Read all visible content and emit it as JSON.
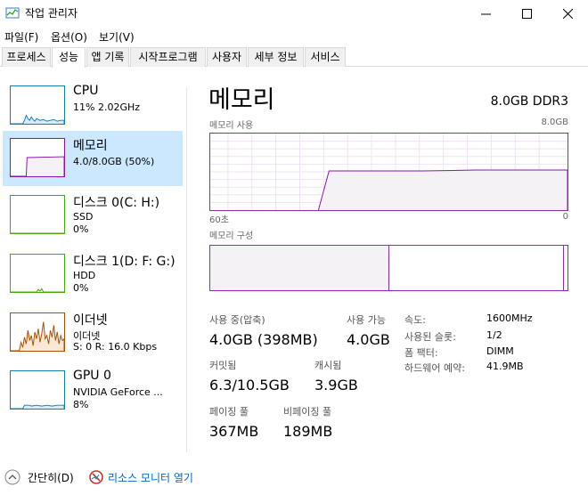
{
  "window": {
    "title": "작업 관리자"
  },
  "menu": [
    "파일(F)",
    "옵션(O)",
    "보기(V)"
  ],
  "tabs": [
    "프로세스",
    "성능",
    "앱 기록",
    "시작프로그램",
    "사용자",
    "세부 정보",
    "서비스"
  ],
  "sidebar": {
    "items": [
      {
        "title": "CPU",
        "lines": [
          "11% 2.02GHz"
        ],
        "color": "#117dbb"
      },
      {
        "title": "메모리",
        "lines": [
          "4.0/8.0GB (50%)"
        ],
        "color": "#8b12ae"
      },
      {
        "title": "디스크 0(C: H:)",
        "lines": [
          "SSD",
          "0%"
        ],
        "color": "#4da60c"
      },
      {
        "title": "디스크 1(D: F: G:)",
        "lines": [
          "HDD",
          "0%"
        ],
        "color": "#4da60c"
      },
      {
        "title": "이더넷",
        "lines": [
          "이더넷",
          "S: 0 R: 16.0 Kbps"
        ],
        "color": "#a74f01"
      },
      {
        "title": "GPU 0",
        "lines": [
          "NVIDIA GeForce ...",
          "8%"
        ],
        "color": "#117dbb"
      }
    ]
  },
  "main": {
    "title": "메모리",
    "spec": "8.0GB DDR3",
    "usage_label": "메모리 사용",
    "usage_max": "8.0GB",
    "time_left": "60초",
    "time_right": "0",
    "composition_label": "메모리 구성",
    "composition_used_fraction": 0.5,
    "stats": {
      "in_use_label": "사용 중(압축)",
      "in_use_value": "4.0GB (398MB)",
      "available_label": "사용 가능",
      "available_value": "4.0GB",
      "committed_label": "커밋됨",
      "committed_value": "6.3/10.5GB",
      "cached_label": "캐시됨",
      "cached_value": "3.9GB",
      "paged_label": "페이징 풀",
      "paged_value": "367MB",
      "nonpaged_label": "비페이징 풀",
      "nonpaged_value": "189MB"
    },
    "details": [
      {
        "k": "속도:",
        "v": "1600MHz"
      },
      {
        "k": "사용된 슬롯:",
        "v": "1/2"
      },
      {
        "k": "폼 팩터:",
        "v": "DIMM"
      },
      {
        "k": "하드웨어 예약:",
        "v": "41.9MB"
      }
    ]
  },
  "footer": {
    "fewer_details": "간단히(D)",
    "resource_monitor": "리소스 모니터 열기"
  },
  "colors": {
    "memory": "#8b12ae",
    "selected_bg": "#cce8ff",
    "link": "#0066cc"
  }
}
